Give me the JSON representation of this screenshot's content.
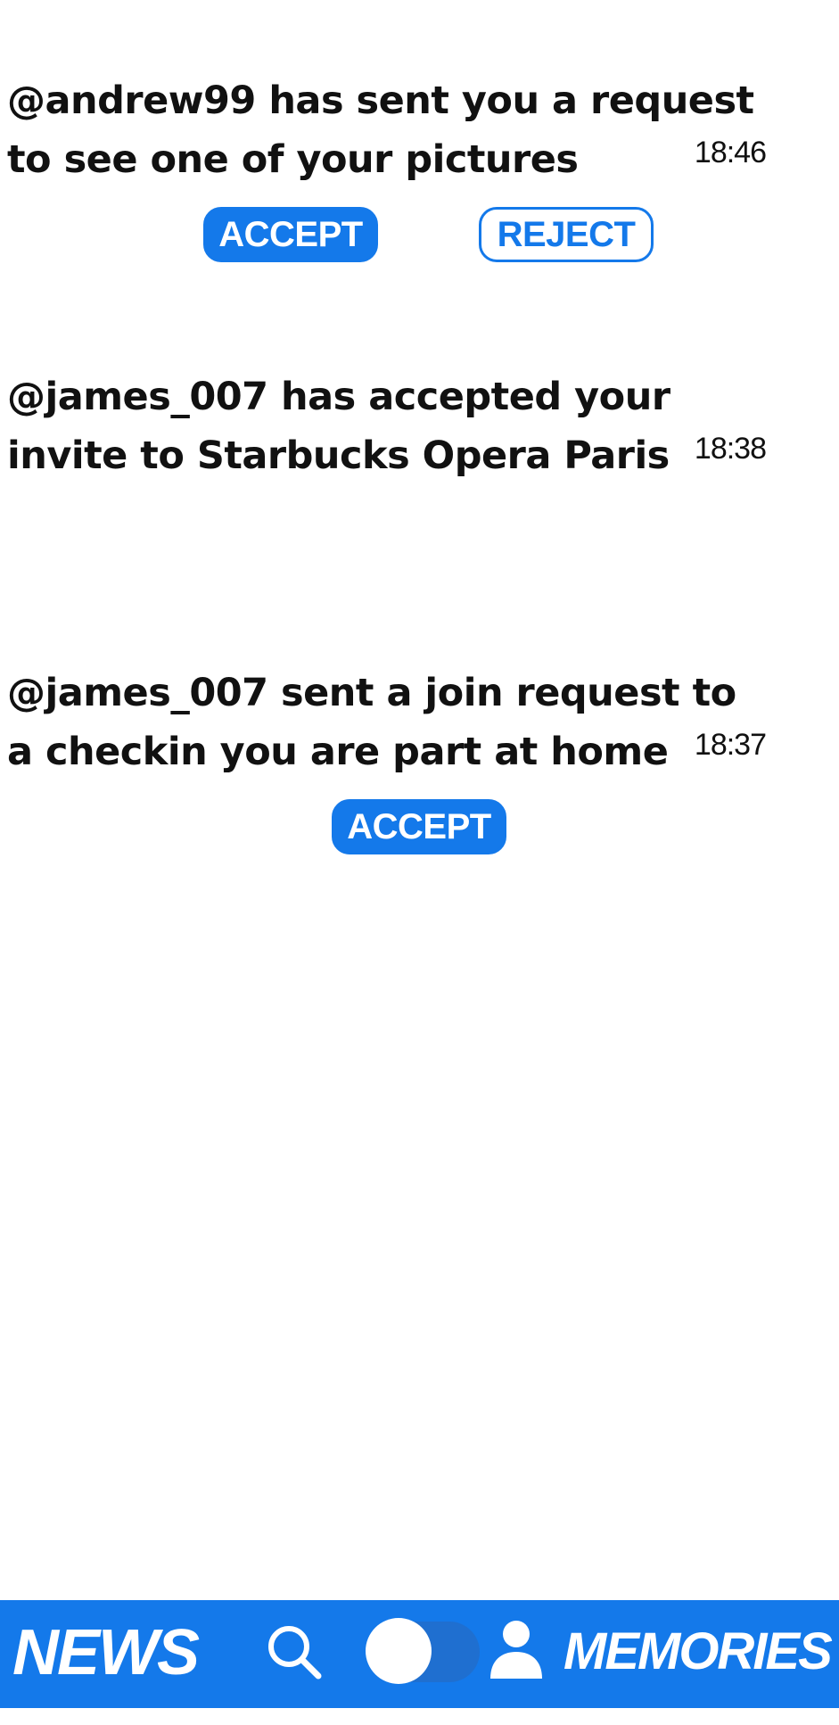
{
  "notifications": [
    {
      "line1": "@andrew99 has sent you a request",
      "line2": "to see one of your pictures",
      "time": "18:46",
      "accept_label": "ACCEPT",
      "reject_label": "REJECT"
    },
    {
      "line1": "@james_007 has accepted your",
      "line2": "invite to Starbucks Opera Paris",
      "time": "18:38"
    },
    {
      "line1": "@james_007 sent a join request to",
      "line2": "a checkin you are part at home",
      "time": "18:37",
      "accept_label": "ACCEPT"
    }
  ],
  "bottom_nav": {
    "news_label": "NEWS",
    "memories_label": "MEMORIES",
    "icons": [
      "search-icon",
      "toggle-switch",
      "profile-icon"
    ],
    "background_color": "#1479ea"
  },
  "colors": {
    "accent": "#1479ea",
    "text": "#111111",
    "background": "#ffffff"
  }
}
